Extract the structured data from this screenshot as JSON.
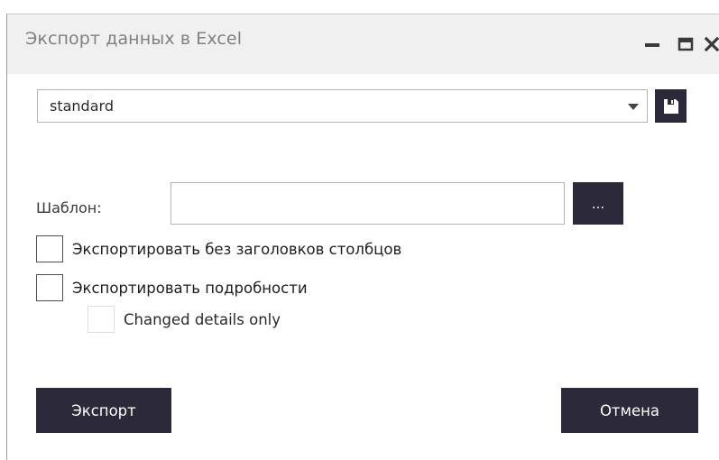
{
  "window": {
    "title": "Экспорт данных в Excel"
  },
  "profile": {
    "selected": "standard"
  },
  "template": {
    "label": "Шаблон:",
    "value": "",
    "browse_label": "..."
  },
  "options": {
    "no_headers_label": "Экспортировать без заголовков столбцов",
    "details_label": "Экспортировать подробности",
    "changed_only_label": "Changed details only"
  },
  "buttons": {
    "export_label": "Экспорт",
    "cancel_label": "Отмена"
  },
  "icons": {
    "minimize": "minimize-icon",
    "maximize": "maximize-icon",
    "close": "close-icon",
    "dropdown": "chevron-down-icon",
    "save": "save-icon"
  },
  "colors": {
    "dark_button": "#2c2a3a",
    "titlebar_bg": "#f0f0f0",
    "title_text": "#808080"
  }
}
